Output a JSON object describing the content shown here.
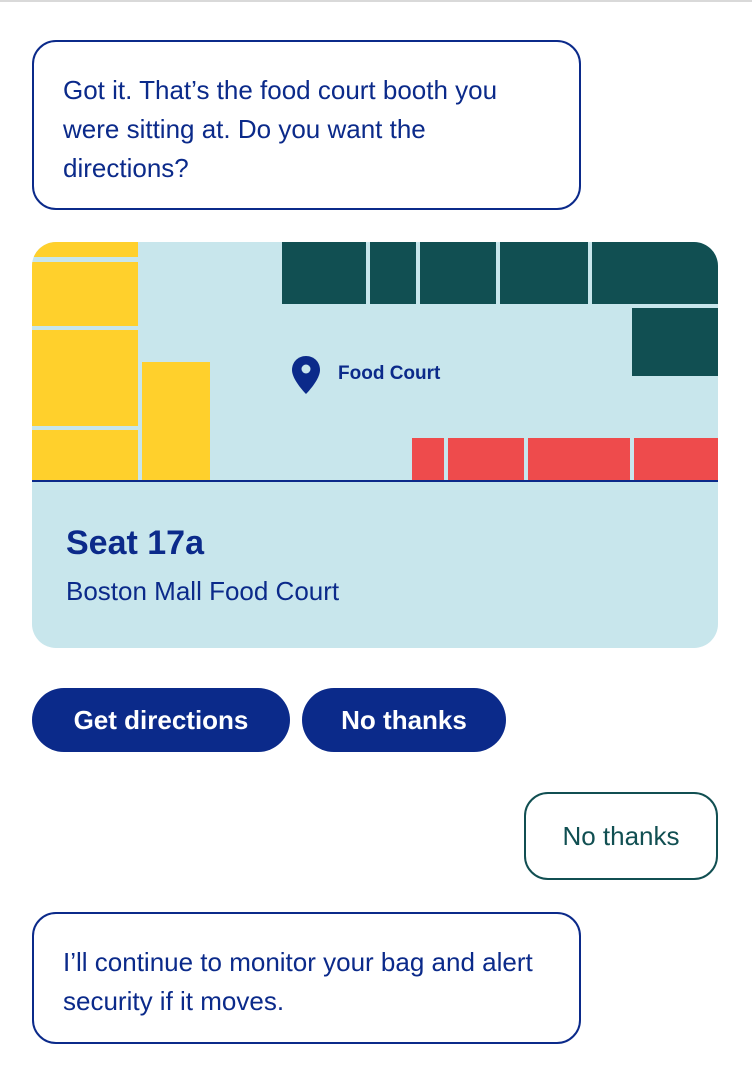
{
  "messages": {
    "bot_first": "Got it. That’s the food court booth you were sitting at. Do you want the directions?",
    "user_reply": "No thanks",
    "bot_second": "I’ll continue to monitor your bag and alert security if it moves."
  },
  "location_card": {
    "map_label": "Food Court",
    "seat": "Seat 17a",
    "place": "Boston Mall Food Court"
  },
  "actions": {
    "directions_label": "Get directions",
    "decline_label": "No thanks"
  },
  "colors": {
    "primary": "#0b2a8a",
    "map_background": "#c8e6ec",
    "yellow_zone": "#ffd02c",
    "green_zone": "#114f52",
    "red_zone": "#ee4b4c"
  },
  "icons": {
    "map_pin": "map-pin-icon"
  }
}
